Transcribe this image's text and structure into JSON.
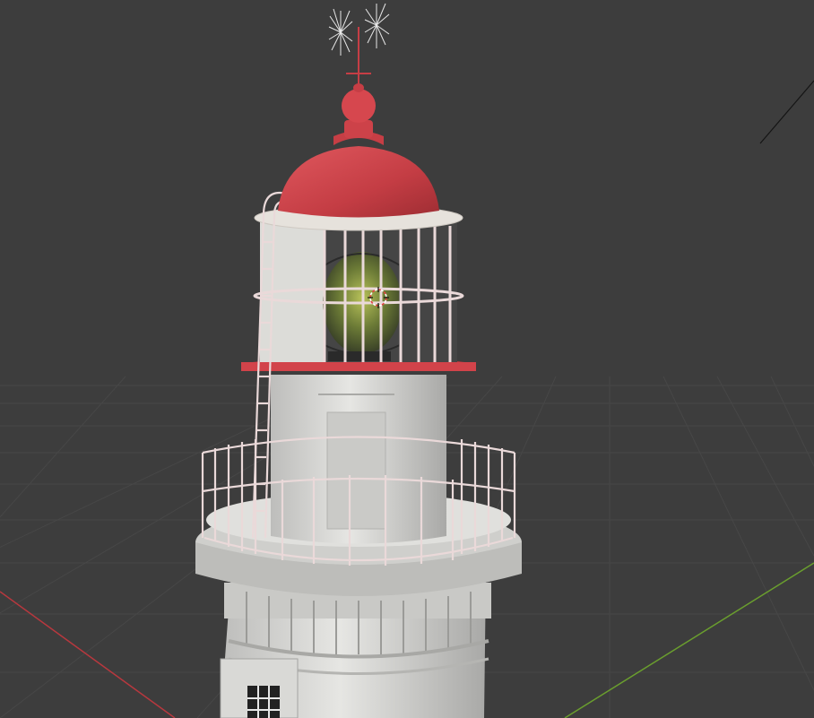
{
  "app": "3D viewport",
  "viewport": {
    "background": "#3d3d3d",
    "grid_color": "#4a4a4a",
    "x_axis_color": "#c0393f",
    "y_axis_color": "#6a9e2e"
  },
  "scene": {
    "object": "lighthouse",
    "colors": {
      "dome_red": "#cf434a",
      "wall_white": "#d8d8d5",
      "rail_pink": "#ead9d9",
      "lens_green": "#6d7e3a"
    }
  },
  "icons": {
    "cursor": "3d-cursor-icon",
    "weathervane": "weathervane-icon"
  }
}
